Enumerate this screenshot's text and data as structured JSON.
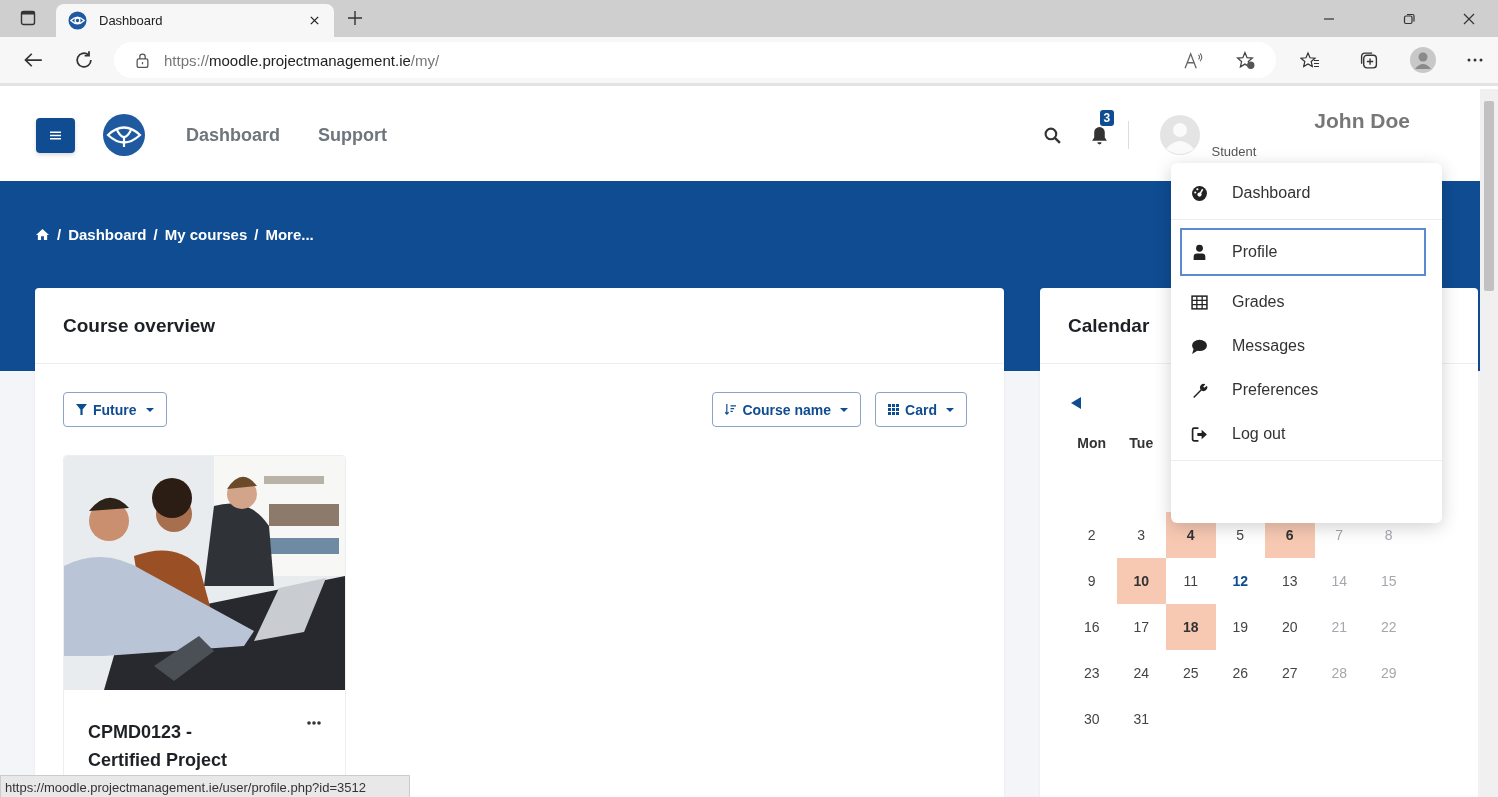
{
  "browser": {
    "tab_title": "Dashboard",
    "url_scheme": "https://",
    "url_host": "moodle.projectmanagement.ie",
    "url_path": "/my/"
  },
  "header": {
    "nav": [
      {
        "label": "Dashboard"
      },
      {
        "label": "Support"
      }
    ],
    "notification_count": "3",
    "user_name": "John Doe",
    "user_role": "Student"
  },
  "breadcrumb": [
    {
      "separator": "/",
      "label": "Dashboard"
    },
    {
      "separator": "/",
      "label": "My courses"
    },
    {
      "separator": "/",
      "label": "More..."
    }
  ],
  "course_overview": {
    "title": "Course overview",
    "filter": "Future",
    "sort": "Course name",
    "view": "Card",
    "courses": [
      {
        "title": "CPMD0123 - Certified Project",
        "kind": "picture"
      }
    ]
  },
  "calendar": {
    "title": "Calendar",
    "weekdays": [
      "Mon",
      "Tue"
    ],
    "days": [
      {
        "day": "2",
        "kind": "normal"
      },
      {
        "day": "3",
        "kind": "normal"
      },
      {
        "day": "4",
        "kind": "event"
      },
      {
        "day": "5",
        "kind": "normal"
      },
      {
        "day": "6",
        "kind": "event"
      },
      {
        "day": "7",
        "kind": "weekend"
      },
      {
        "day": "8",
        "kind": "weekend"
      },
      {
        "day": "9",
        "kind": "normal"
      },
      {
        "day": "10",
        "kind": "event"
      },
      {
        "day": "11",
        "kind": "normal"
      },
      {
        "day": "12",
        "kind": "today"
      },
      {
        "day": "13",
        "kind": "normal"
      },
      {
        "day": "14",
        "kind": "weekend"
      },
      {
        "day": "15",
        "kind": "weekend"
      },
      {
        "day": "16",
        "kind": "normal"
      },
      {
        "day": "17",
        "kind": "normal"
      },
      {
        "day": "18",
        "kind": "event"
      },
      {
        "day": "19",
        "kind": "normal"
      },
      {
        "day": "20",
        "kind": "normal"
      },
      {
        "day": "21",
        "kind": "weekend"
      },
      {
        "day": "22",
        "kind": "weekend"
      },
      {
        "day": "23",
        "kind": "normal"
      },
      {
        "day": "24",
        "kind": "normal"
      },
      {
        "day": "25",
        "kind": "normal"
      },
      {
        "day": "26",
        "kind": "normal"
      },
      {
        "day": "27",
        "kind": "normal"
      },
      {
        "day": "28",
        "kind": "weekend"
      },
      {
        "day": "29",
        "kind": "weekend"
      },
      {
        "day": "30",
        "kind": "normal"
      },
      {
        "day": "31",
        "kind": "normal"
      }
    ]
  },
  "user_menu": {
    "items": [
      {
        "label": "Dashboard",
        "kind": "dashboard",
        "selected": false,
        "divider_after": true
      },
      {
        "label": "Profile",
        "kind": "profile",
        "selected": true,
        "divider_after": false
      },
      {
        "label": "Grades",
        "kind": "grades",
        "selected": false,
        "divider_after": false
      },
      {
        "label": "Messages",
        "kind": "messages",
        "selected": false,
        "divider_after": false
      },
      {
        "label": "Preferences",
        "kind": "preferences",
        "selected": false,
        "divider_after": false
      },
      {
        "label": "Log out",
        "kind": "logout",
        "selected": false,
        "divider_after": true
      }
    ]
  },
  "status_url": "https://moodle.projectmanagement.ie/user/profile.php?id=3512"
}
